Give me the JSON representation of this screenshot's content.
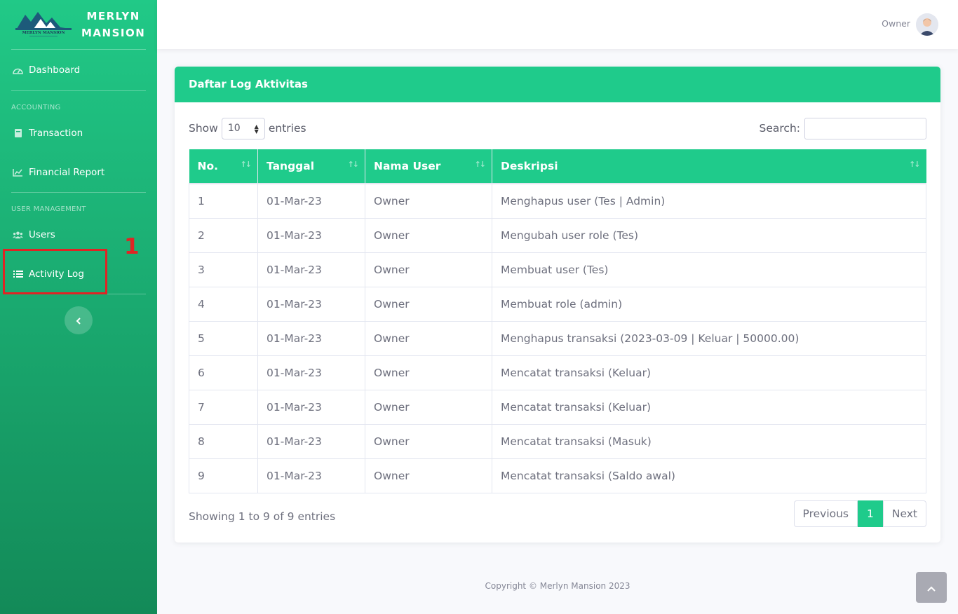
{
  "brand": {
    "line1": "MERLYN",
    "line2": "MANSION",
    "logo_text": "MERLYN MANSION"
  },
  "sidebar": {
    "items": [
      {
        "label": "Dashboard",
        "icon": "tachometer-icon"
      },
      {
        "heading": "ACCOUNTING"
      },
      {
        "label": "Transaction",
        "icon": "book-icon"
      },
      {
        "label": "Financial Report",
        "icon": "chart-area-icon"
      },
      {
        "heading": "USER MANAGEMENT"
      },
      {
        "label": "Users",
        "icon": "users-icon"
      },
      {
        "label": "Activity Log",
        "icon": "list-icon"
      }
    ],
    "annotation": "1"
  },
  "topbar": {
    "user_name": "Owner"
  },
  "card": {
    "title": "Daftar Log Aktivitas",
    "show_label": "Show",
    "entries_label": "entries",
    "page_length": "10",
    "search_label": "Search:"
  },
  "table": {
    "headers": [
      "No.",
      "Tanggal",
      "Nama User",
      "Deskripsi"
    ],
    "rows": [
      [
        "1",
        "01-Mar-23",
        "Owner",
        "Menghapus user (Tes | Admin)"
      ],
      [
        "2",
        "01-Mar-23",
        "Owner",
        "Mengubah user role (Tes)"
      ],
      [
        "3",
        "01-Mar-23",
        "Owner",
        "Membuat user (Tes)"
      ],
      [
        "4",
        "01-Mar-23",
        "Owner",
        "Membuat role (admin)"
      ],
      [
        "5",
        "01-Mar-23",
        "Owner",
        "Menghapus transaksi (2023-03-09 | Keluar | 50000.00)"
      ],
      [
        "6",
        "01-Mar-23",
        "Owner",
        "Mencatat transaksi (Keluar)"
      ],
      [
        "7",
        "01-Mar-23",
        "Owner",
        "Mencatat transaksi (Keluar)"
      ],
      [
        "8",
        "01-Mar-23",
        "Owner",
        "Mencatat transaksi (Masuk)"
      ],
      [
        "9",
        "01-Mar-23",
        "Owner",
        "Mencatat transaksi (Saldo awal)"
      ]
    ]
  },
  "pagination": {
    "info": "Showing 1 to 9 of 9 entries",
    "previous": "Previous",
    "current": "1",
    "next": "Next"
  },
  "footer": {
    "copyright": "Copyright © Merlyn Mansion 2023"
  },
  "colors": {
    "primary": "#1fcb8b",
    "sidebar_top": "#21c987",
    "sidebar_bottom": "#138a58",
    "annotation": "#e02424"
  }
}
